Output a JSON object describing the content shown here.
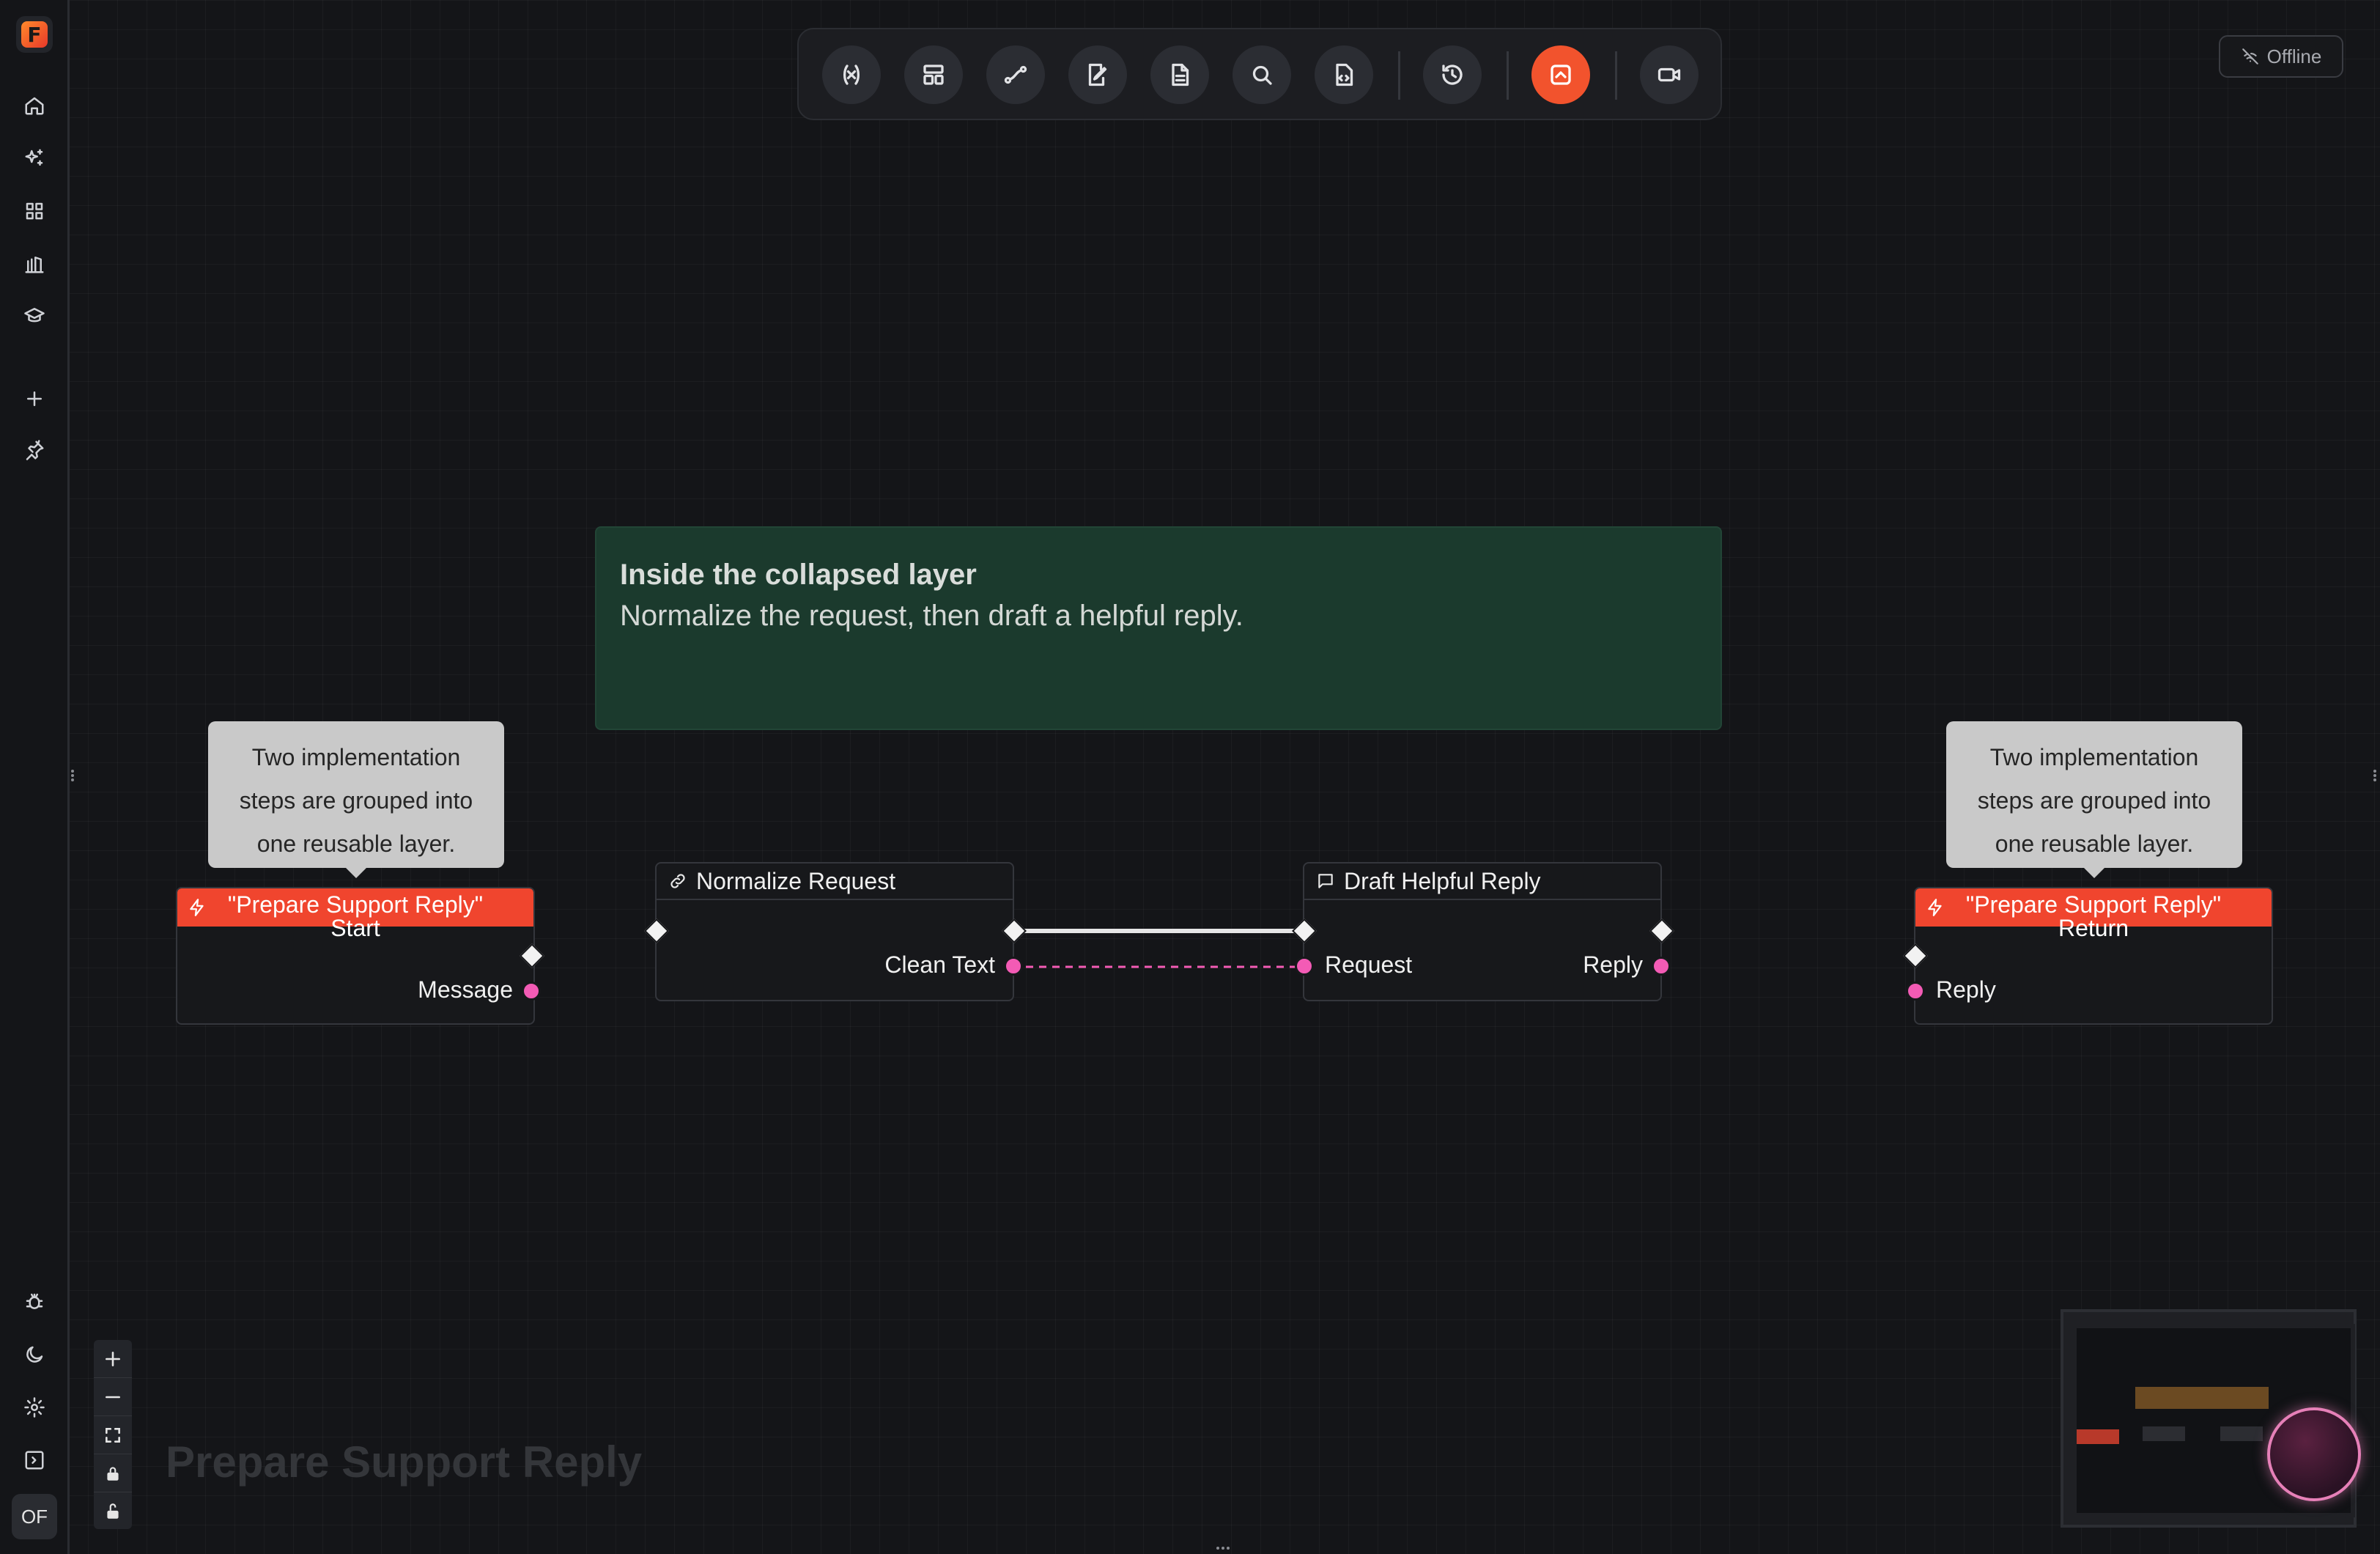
{
  "app": {
    "logo_letter": "F",
    "avatar_initials": "OF",
    "status": "Offline",
    "graph_title": "Prepare Support Reply"
  },
  "sidebar": {
    "top_icons": [
      "home-icon",
      "sparkles-icon",
      "grid-icon",
      "library-icon",
      "graduation-cap-icon"
    ],
    "mid_icons": [
      "plus-icon",
      "pin-icon"
    ],
    "bottom_icons": [
      "bug-icon",
      "moon-icon",
      "settings-icon",
      "panel-collapse-icon"
    ]
  },
  "toolbar": {
    "buttons": [
      "variable-icon",
      "layout-icon",
      "connection-icon",
      "edit-notes-icon",
      "document-icon",
      "search-icon",
      "code-file-icon",
      "history-icon",
      "minimize-layer-icon",
      "video-camera-icon"
    ],
    "active": "minimize-layer-icon",
    "accent": "#f2532d"
  },
  "comment": {
    "title": "Inside the collapsed layer",
    "body": "Normalize the request, then draft a helpful reply.",
    "color": "#1b3a2d"
  },
  "notes": {
    "left": [
      "Two implementation",
      "steps are grouped into",
      "one reusable layer."
    ],
    "right": [
      "Two implementation",
      "steps are grouped into",
      "one reusable layer."
    ]
  },
  "nodes": {
    "start": {
      "title_line1": "\"Prepare Support Reply\"",
      "title_line2": "Start",
      "output_label": "Message",
      "color": "#f0452e"
    },
    "normalize": {
      "title": "Normalize Request",
      "output_label": "Clean Text"
    },
    "draft": {
      "title": "Draft Helpful Reply",
      "input_label": "Request",
      "output_label": "Reply"
    },
    "return": {
      "title_line1": "\"Prepare Support Reply\"",
      "title_line2": "Return",
      "input_label": "Reply",
      "color": "#f0452e"
    }
  },
  "zoom_controls": [
    "zoom-in-icon",
    "zoom-out-icon",
    "fit-view-icon",
    "lock-icon",
    "unlock-icon"
  ],
  "colors": {
    "data_pin": "#f35bb5",
    "exec_wire": "#e6e6e6"
  }
}
